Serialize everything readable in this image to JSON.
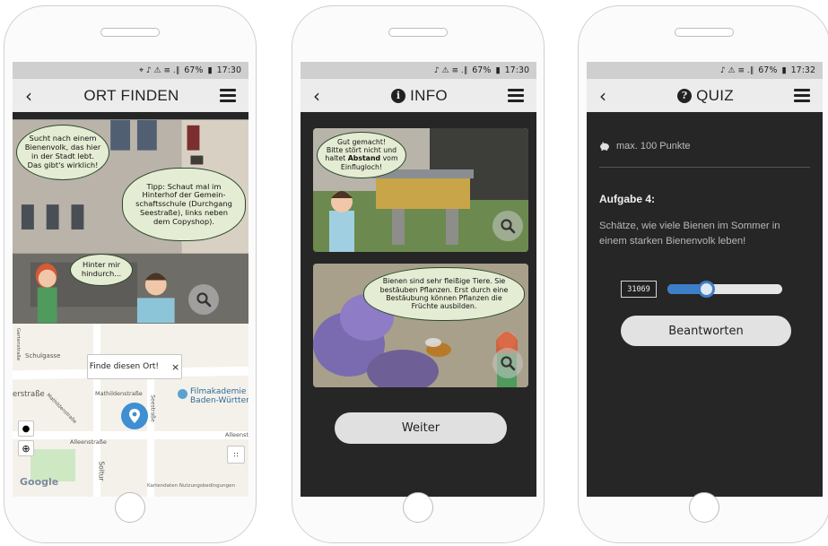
{
  "phones": [
    {
      "status": {
        "icons": "⌖ ♪ ⚠ ≡ .∥",
        "battery": "67%",
        "time": "17:30"
      },
      "title": "ORT FINDEN",
      "comic_bubbles": [
        "Sucht nach einem Bienenvolk, das hier in der Stadt lebt. Das gibt's wirklich!",
        "Tipp: Schaut mal im Hinterhof der Gemein-schaftsschule (Durchgang Seestraße), links neben dem Copyshop).",
        "Hinter mir hindurch..."
      ],
      "map": {
        "popup": "Finde diesen Ort!",
        "popup_close": "×",
        "streets": [
          "Schulgasse",
          "erstraße",
          "Mathildenstraße",
          "Seestraße",
          "Alleenstraße",
          "Alleenst",
          "Gartenstraße",
          "Mathildenstraße",
          "Soltur"
        ],
        "poi": "Filmakademie Baden-Württem",
        "google": "Google",
        "footer": "Kartendaten   Nutzungsbedingungen"
      }
    },
    {
      "status": {
        "icons": "♪ ⚠ ≡ .∥",
        "battery": "67%",
        "time": "17:30"
      },
      "title": "INFO",
      "bubble1": {
        "line1": "Gut gemacht!",
        "line2": "Bitte stört nicht und",
        "line3_pre": "haltet ",
        "bold": "Abstand",
        "line3_post": " vom",
        "line4": "Einflugloch!"
      },
      "bubble2": "Bienen sind sehr fleißige Tiere. Sie bestäuben Pflanzen. Erst durch eine Bestäubung können Pflanzen die Früchte ausbilden.",
      "button": "Weiter"
    },
    {
      "status": {
        "icons": "♪ ⚠ ≡ .∥",
        "battery": "67%",
        "time": "17:32"
      },
      "title": "QUIZ",
      "points": "max. 100 Punkte",
      "task_label": "Aufgabe 4:",
      "question": "Schätze, wie viele Bienen im Sommer in einem starken Bienenvolk leben!",
      "slider_value": "31069",
      "slider_fraction": 0.31,
      "button": "Beantworten"
    }
  ],
  "colors": {
    "screen_bg": "#262626",
    "bar_bg": "#ececec",
    "status_bg": "#cfcfcf",
    "slider_blue": "#3d7ec9",
    "pin_blue": "#3f8fd2",
    "bubble_bg": "#e5ecd4"
  }
}
